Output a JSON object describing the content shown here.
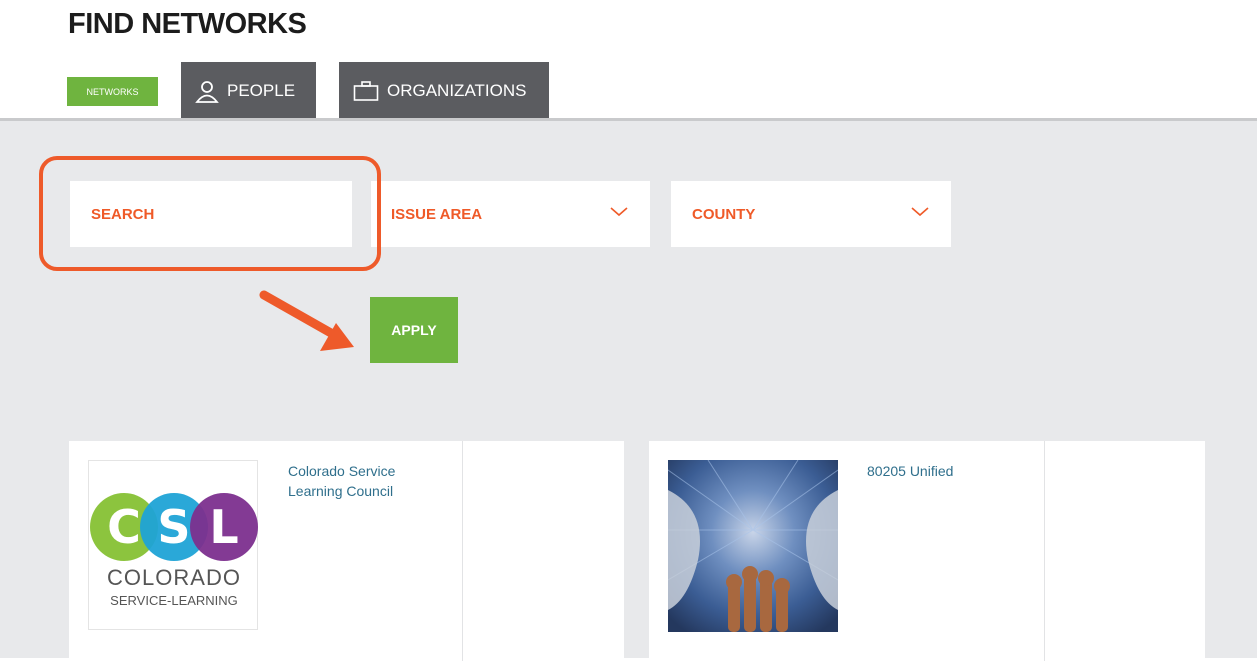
{
  "page": {
    "title": "FIND NETWORKS"
  },
  "tabs": [
    {
      "label": "NETWORKS",
      "icon": null,
      "active": true
    },
    {
      "label": "PEOPLE",
      "icon": "person-icon",
      "active": false
    },
    {
      "label": "ORGANIZATIONS",
      "icon": "briefcase-icon",
      "active": false
    }
  ],
  "filters": {
    "search": {
      "placeholder": "SEARCH"
    },
    "issue_area": {
      "label": "ISSUE AREA",
      "icon": "chevron-down-icon"
    },
    "county": {
      "label": "COUNTY",
      "icon": "chevron-down-icon"
    }
  },
  "apply_label": "APPLY",
  "annotation": {
    "highlight_color": "#ee5a2a",
    "arrow_icon": "arrow-right-down-icon"
  },
  "results": [
    {
      "name": "Colorado Service Learning Council",
      "logo": {
        "letters": [
          "C",
          "S",
          "L"
        ],
        "line1": "COLORADO",
        "line2": "SERVICE-LEARNING"
      }
    },
    {
      "name": "80205 Unified",
      "image": "hands-raised-photo"
    }
  ],
  "colors": {
    "accent_green": "#6fb43f",
    "accent_orange": "#ef5a28",
    "tab_gray": "#5b5c60",
    "link_blue": "#2f6f8c"
  }
}
